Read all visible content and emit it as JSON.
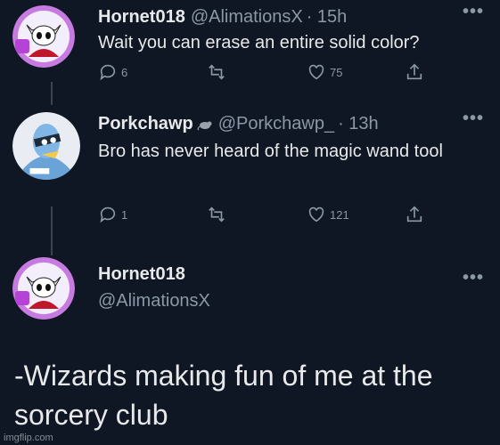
{
  "tweets": [
    {
      "name": "Hornet018",
      "handle": "@AlimationsX",
      "time": "· 15h",
      "text": "Wait you can erase an entire solid color?",
      "replies": "6",
      "retweets": "",
      "likes": "75"
    },
    {
      "name": "Porkchawp",
      "handle": "@Porkchawp_",
      "time": "· 13h",
      "text": "Bro has never heard of the magic wand tool",
      "replies": "1",
      "retweets": "",
      "likes": "121"
    },
    {
      "name": "Hornet018",
      "handle": "@AlimationsX",
      "text": "-Wizards making fun of me at the sorcery club"
    }
  ],
  "more_label": "•••",
  "watermark": "imgflip.com",
  "colors": {
    "background": "#0f1624",
    "text": "#e7e9ea",
    "muted": "#8b98a5"
  }
}
